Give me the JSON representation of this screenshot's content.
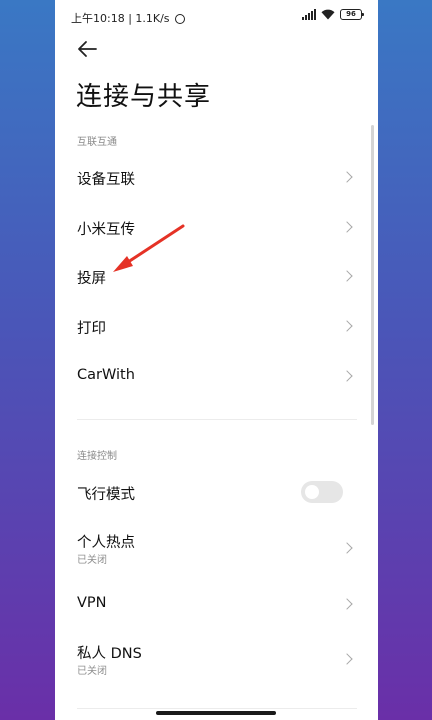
{
  "status_bar": {
    "time_speed": "上午10:18 | 1.1K/s",
    "battery": "96"
  },
  "page": {
    "title": "连接与共享"
  },
  "sections": [
    {
      "label": "互联互通",
      "items": [
        {
          "label": "设备互联"
        },
        {
          "label": "小米互传"
        },
        {
          "label": "投屏"
        },
        {
          "label": "打印"
        },
        {
          "label": "CarWith"
        }
      ]
    },
    {
      "label": "连接控制",
      "items": [
        {
          "label": "飞行模式",
          "toggle": false
        },
        {
          "label": "个人热点",
          "sub": "已关闭"
        },
        {
          "label": "VPN"
        },
        {
          "label": "私人 DNS",
          "sub": "已关闭"
        }
      ]
    }
  ],
  "colors": {
    "annotation_arrow": "#e53226",
    "toggle_off": "#e6e6e6",
    "background_top": "#3a78c4",
    "background_bottom": "#6a2fa8"
  },
  "icons": [
    "back-arrow-icon",
    "alarm-icon",
    "signal-icon",
    "wifi-icon",
    "battery-icon",
    "chevron-right-icon"
  ]
}
